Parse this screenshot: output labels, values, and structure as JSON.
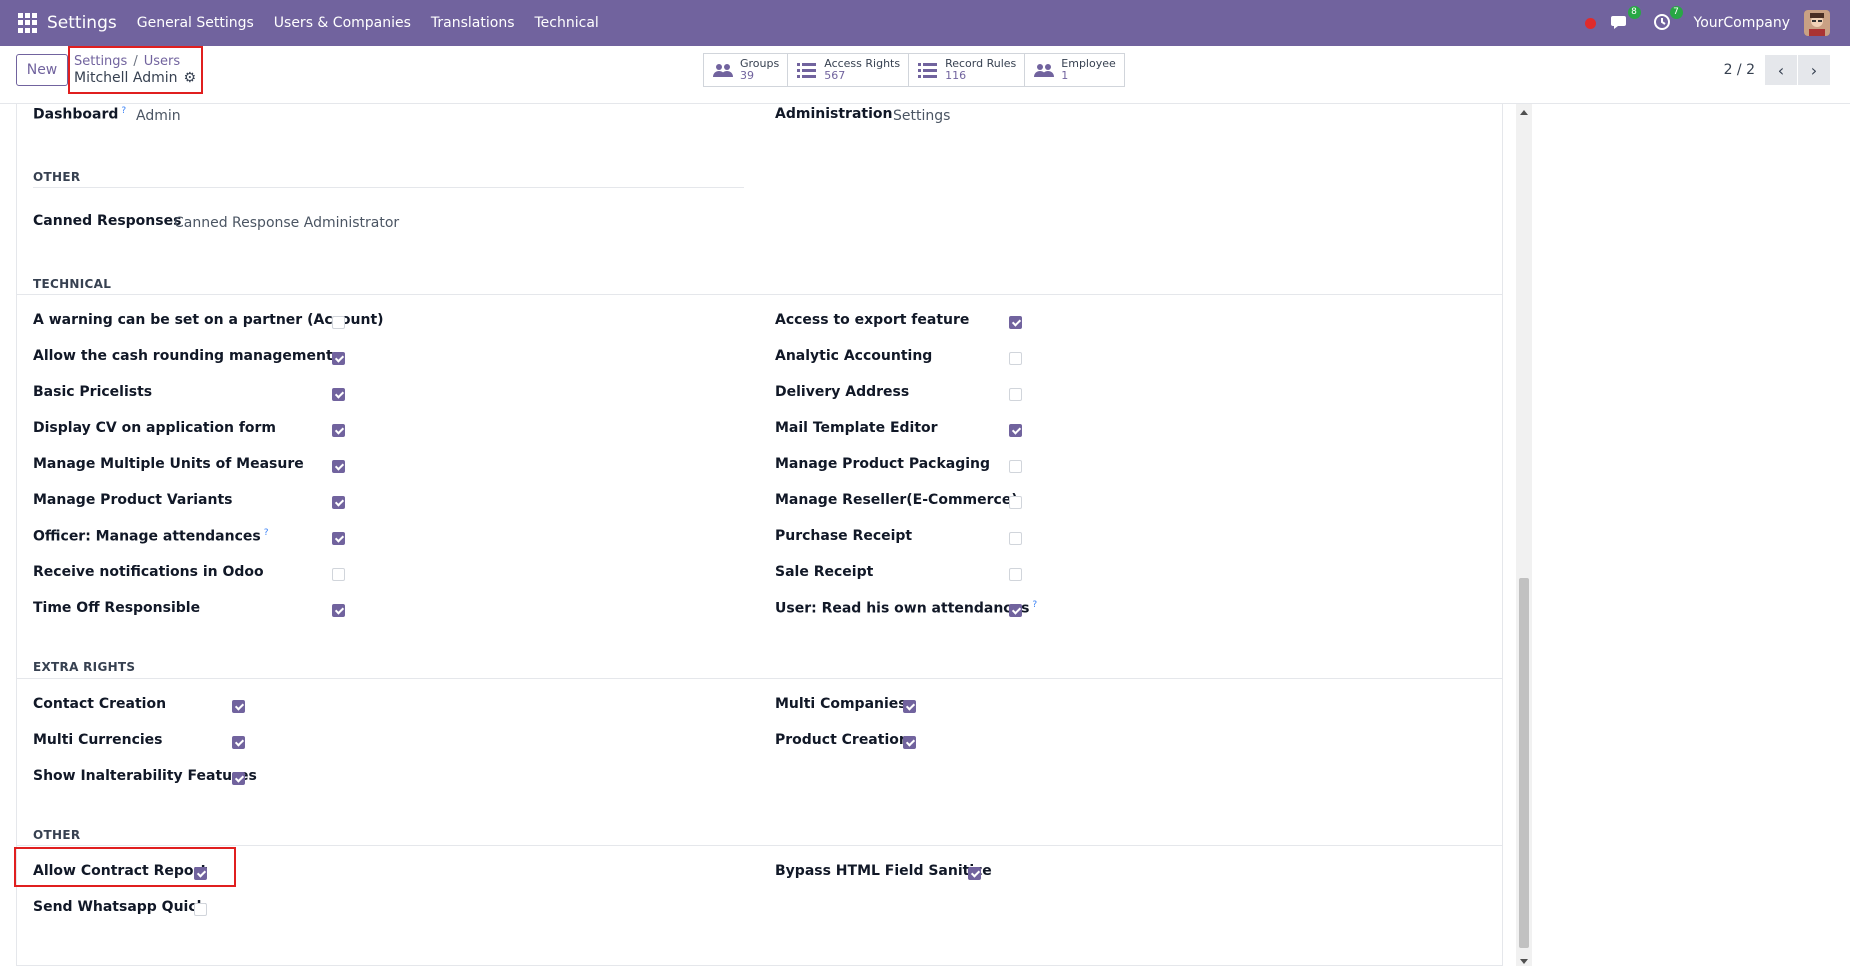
{
  "navbar": {
    "brand": "Settings",
    "menu": [
      "General Settings",
      "Users & Companies",
      "Translations",
      "Technical"
    ],
    "messages_badge": "8",
    "activities_badge": "7",
    "company": "YourCompany"
  },
  "control": {
    "new_label": "New",
    "breadcrumb": {
      "settings": "Settings",
      "users": "Users",
      "separator": "/",
      "current": "Mitchell Admin"
    },
    "stats": [
      {
        "label": "Groups",
        "value": "39",
        "icon": "users-icon"
      },
      {
        "label": "Access Rights",
        "value": "567",
        "icon": "list-icon"
      },
      {
        "label": "Record Rules",
        "value": "116",
        "icon": "list-icon"
      },
      {
        "label": "Employee",
        "value": "1",
        "icon": "users-icon"
      }
    ],
    "pager": "2 / 2"
  },
  "form": {
    "top": {
      "dashboard_label": "Dashboard",
      "dashboard_value": "Admin",
      "administration_label": "Administration",
      "administration_value": "Settings"
    },
    "other1": {
      "title": "OTHER",
      "canned_label": "Canned Responses",
      "canned_value": "Canned Response Administrator"
    },
    "technical": {
      "title": "TECHNICAL",
      "left": [
        {
          "label": "A warning can be set on a partner (Account)",
          "checked": false
        },
        {
          "label": "Allow the cash rounding management",
          "checked": true
        },
        {
          "label": "Basic Pricelists",
          "checked": true
        },
        {
          "label": "Display CV on application form",
          "checked": true
        },
        {
          "label": "Manage Multiple Units of Measure",
          "checked": true
        },
        {
          "label": "Manage Product Variants",
          "checked": true
        },
        {
          "label": "Officer: Manage attendances",
          "checked": true,
          "help": "?"
        },
        {
          "label": "Receive notifications in Odoo",
          "checked": false
        },
        {
          "label": "Time Off Responsible",
          "checked": true
        }
      ],
      "right": [
        {
          "label": "Access to export feature",
          "checked": true
        },
        {
          "label": "Analytic Accounting",
          "checked": false
        },
        {
          "label": "Delivery Address",
          "checked": false
        },
        {
          "label": "Mail Template Editor",
          "checked": true
        },
        {
          "label": "Manage Product Packaging",
          "checked": false
        },
        {
          "label": "Manage Reseller(E-Commerce)",
          "checked": false
        },
        {
          "label": "Purchase Receipt",
          "checked": false
        },
        {
          "label": "Sale Receipt",
          "checked": false
        },
        {
          "label": "User: Read his own attendances",
          "checked": true,
          "help": "?"
        }
      ]
    },
    "extra": {
      "title": "EXTRA RIGHTS",
      "left": [
        {
          "label": "Contact Creation",
          "checked": true
        },
        {
          "label": "Multi Currencies",
          "checked": true
        },
        {
          "label": "Show Inalterability Features",
          "checked": true
        }
      ],
      "right": [
        {
          "label": "Multi Companies",
          "checked": true
        },
        {
          "label": "Product Creation",
          "checked": true
        }
      ]
    },
    "other2": {
      "title": "OTHER",
      "left": [
        {
          "label": "Allow Contract Report",
          "checked": true
        },
        {
          "label": "Send Whatsapp Quick",
          "checked": false
        }
      ],
      "right": [
        {
          "label": "Bypass HTML Field Sanitize",
          "checked": true
        }
      ]
    },
    "help_mark": "?"
  }
}
